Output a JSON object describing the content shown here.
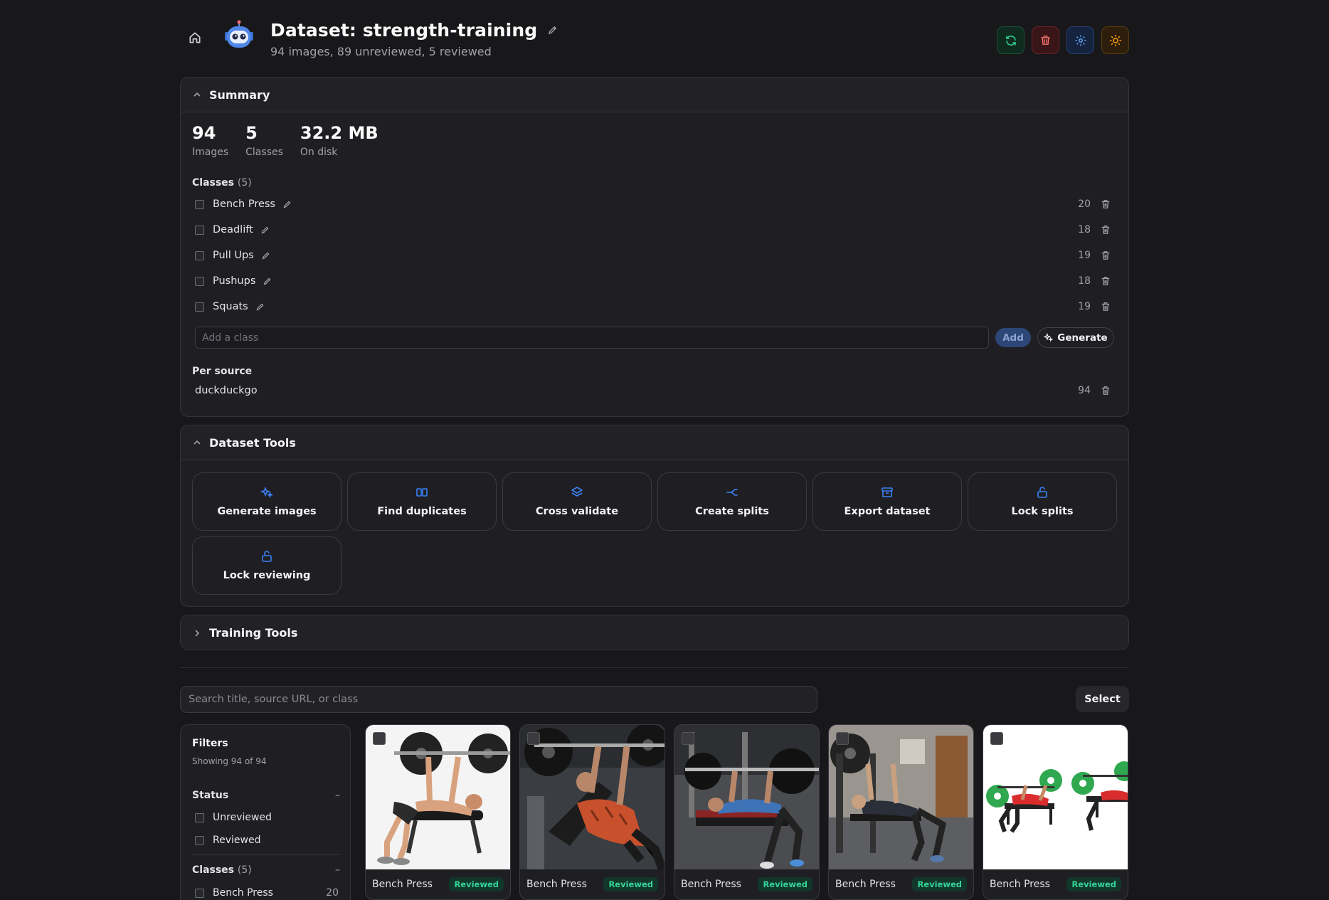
{
  "header": {
    "title": "Dataset: strength-training",
    "subtitle": "94 images, 89 unreviewed, 5 reviewed"
  },
  "summary": {
    "title": "Summary",
    "stats": [
      {
        "value": "94",
        "label": "Images"
      },
      {
        "value": "5",
        "label": "Classes"
      },
      {
        "value": "32.2 MB",
        "label": "On disk"
      }
    ],
    "classes_heading": "Classes",
    "classes_count": "(5)",
    "classes": [
      {
        "name": "Bench Press",
        "count": "20"
      },
      {
        "name": "Deadlift",
        "count": "18"
      },
      {
        "name": "Pull Ups",
        "count": "19"
      },
      {
        "name": "Pushups",
        "count": "18"
      },
      {
        "name": "Squats",
        "count": "19"
      }
    ],
    "add_placeholder": "Add a class",
    "add_label": "Add",
    "generate_label": "Generate",
    "per_source_heading": "Per source",
    "sources": [
      {
        "name": "duckduckgo",
        "count": "94"
      }
    ]
  },
  "tools": {
    "title": "Dataset Tools",
    "items": [
      {
        "label": "Generate images",
        "icon": "sparkles-icon"
      },
      {
        "label": "Find duplicates",
        "icon": "columns-icon"
      },
      {
        "label": "Cross validate",
        "icon": "layers-icon"
      },
      {
        "label": "Create splits",
        "icon": "split-icon"
      },
      {
        "label": "Export dataset",
        "icon": "archive-icon"
      },
      {
        "label": "Lock splits",
        "icon": "unlock-icon"
      },
      {
        "label": "Lock reviewing",
        "icon": "unlock-icon"
      }
    ]
  },
  "training": {
    "title": "Training Tools"
  },
  "search": {
    "placeholder": "Search title, source URL, or class",
    "select_label": "Select"
  },
  "filters": {
    "title": "Filters",
    "showing": "Showing 94 of 94",
    "status_heading": "Status",
    "collapse_symbol": "–",
    "status_options": [
      "Unreviewed",
      "Reviewed"
    ],
    "classes_heading": "Classes",
    "classes_count": "(5)",
    "class_options": [
      {
        "name": "Bench Press",
        "count": "20"
      }
    ]
  },
  "gallery": {
    "cards": [
      {
        "label": "Bench Press",
        "status": "Reviewed"
      },
      {
        "label": "Bench Press",
        "status": "Reviewed"
      },
      {
        "label": "Bench Press",
        "status": "Reviewed"
      },
      {
        "label": "Bench Press",
        "status": "Reviewed"
      },
      {
        "label": "Bench Press",
        "status": "Reviewed"
      }
    ]
  },
  "colors": {
    "background": "#18181b",
    "panel": "#1f1f23",
    "accent": "#3b82f6",
    "reviewed": "#34d399",
    "danger": "#f87171",
    "warning": "#f59e0b"
  }
}
